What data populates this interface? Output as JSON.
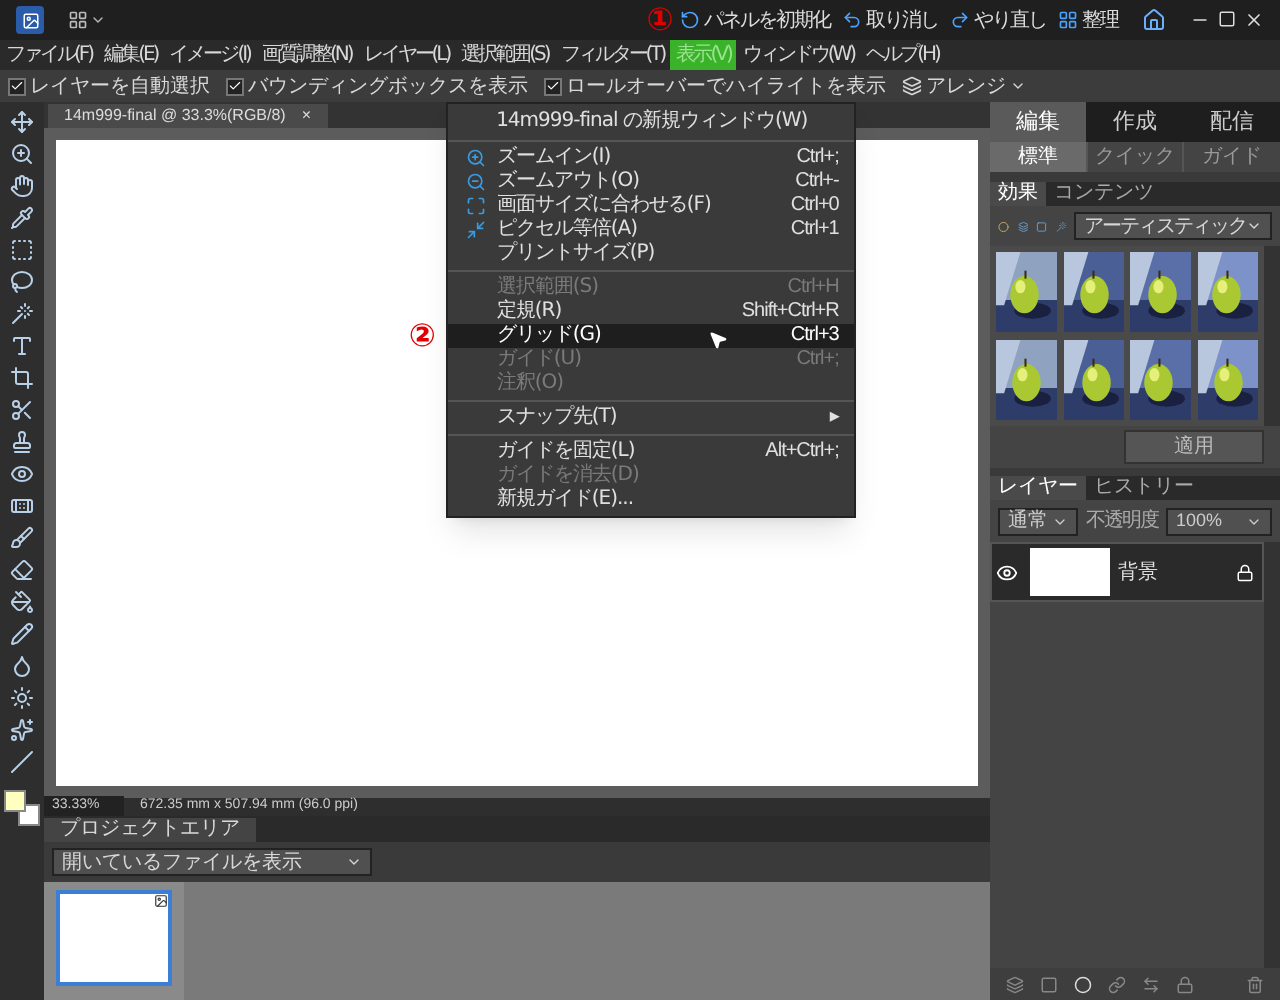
{
  "app_bar": {
    "actions": [
      {
        "label": "パネルを初期化"
      },
      {
        "label": "取り消し"
      },
      {
        "label": "やり直し"
      },
      {
        "label": "整理"
      }
    ]
  },
  "menu_bar": [
    {
      "label": "ファイル(F)",
      "selected": false
    },
    {
      "label": "編集(E)",
      "selected": false
    },
    {
      "label": "イメージ(I)",
      "selected": false
    },
    {
      "label": "画質調整(N)",
      "selected": false
    },
    {
      "label": "レイヤー(L)",
      "selected": false
    },
    {
      "label": "選択範囲(S)",
      "selected": false
    },
    {
      "label": "フィルター(T)",
      "selected": false
    },
    {
      "label": "表示(V)",
      "selected": true,
      "annotation": "①"
    },
    {
      "label": "ウィンドウ(W)",
      "selected": false
    },
    {
      "label": "ヘルプ(H)",
      "selected": false
    }
  ],
  "options_bar": {
    "checkboxes": [
      {
        "label": "レイヤーを自動選択",
        "checked": true
      },
      {
        "label": "バウンディングボックスを表示",
        "checked": true
      },
      {
        "label": "ロールオーバーでハイライトを表示",
        "checked": true
      }
    ],
    "arrange": "アレンジ"
  },
  "document_tab": {
    "title": "14m999-final @ 33.3%(RGB/8)",
    "close": "×"
  },
  "view_menu": {
    "items": [
      {
        "kind": "header",
        "label": "14m999-final の新規ウィンドウ(W)"
      },
      {
        "kind": "separator"
      },
      {
        "kind": "item",
        "label": "ズームイン(I)",
        "shortcut": "Ctrl+;",
        "icon": true,
        "disabled": false,
        "selected": false
      },
      {
        "kind": "item",
        "label": "ズームアウト(O)",
        "shortcut": "Ctrl+-",
        "icon": true,
        "disabled": false,
        "selected": false
      },
      {
        "kind": "item",
        "label": "画面サイズに合わせる(F)",
        "shortcut": "Ctrl+0",
        "icon": true,
        "disabled": false,
        "selected": false
      },
      {
        "kind": "item",
        "label": "ピクセル等倍(A)",
        "shortcut": "Ctrl+1",
        "icon": true,
        "disabled": false,
        "selected": false
      },
      {
        "kind": "item",
        "label": "プリントサイズ(P)",
        "disabled": false,
        "selected": false
      },
      {
        "kind": "separator"
      },
      {
        "kind": "item",
        "label": "選択範囲(S)",
        "shortcut": "Ctrl+H",
        "disabled": true,
        "selected": false
      },
      {
        "kind": "item",
        "label": "定規(R)",
        "shortcut": "Shift+Ctrl+R",
        "disabled": false,
        "selected": false
      },
      {
        "kind": "item",
        "label": "グリッド(G)",
        "shortcut": "Ctrl+3",
        "disabled": false,
        "selected": true,
        "annotation": "②"
      },
      {
        "kind": "item",
        "label": "ガイド(U)",
        "shortcut": "Ctrl+;",
        "disabled": true,
        "selected": false
      },
      {
        "kind": "item",
        "label": "注釈(O)",
        "disabled": true,
        "selected": false
      },
      {
        "kind": "separator"
      },
      {
        "kind": "submenu",
        "label": "スナップ先(T)",
        "arrow": "▸"
      },
      {
        "kind": "separator"
      },
      {
        "kind": "item",
        "label": "ガイドを固定(L)",
        "shortcut": "Alt+Ctrl+;",
        "disabled": false,
        "selected": false
      },
      {
        "kind": "item",
        "label": "ガイドを消去(D)",
        "disabled": true,
        "selected": false
      },
      {
        "kind": "item",
        "label": "新規ガイド(E)...",
        "disabled": false,
        "selected": false
      }
    ]
  },
  "status_bar": {
    "zoom": "33.33%",
    "size": "672.35 mm x 507.94 mm (96.0 ppi)"
  },
  "project_bin": {
    "title": "プロジェクトエリア",
    "filter": "開いているファイルを表示"
  },
  "panel": {
    "modes": [
      {
        "label": "編集",
        "selected": true
      },
      {
        "label": "作成",
        "selected": false
      },
      {
        "label": "配信",
        "selected": false
      }
    ],
    "submodes": [
      {
        "label": "標準",
        "selected": true
      },
      {
        "label": "クイック",
        "selected": false
      },
      {
        "label": "ガイド",
        "selected": false
      }
    ],
    "effects": {
      "tabs": [
        {
          "label": "効果",
          "selected": true
        },
        {
          "label": "コンテンツ",
          "selected": false
        }
      ],
      "category": "アーティスティック",
      "apply": "適用"
    },
    "layers": {
      "tabs": [
        {
          "label": "レイヤー",
          "selected": true
        },
        {
          "label": "ヒストリー",
          "selected": false
        }
      ],
      "blend": "通常",
      "opacity_label": "不透明度",
      "opacity": "100%",
      "items": [
        {
          "name": "背景",
          "locked": true
        }
      ]
    }
  }
}
